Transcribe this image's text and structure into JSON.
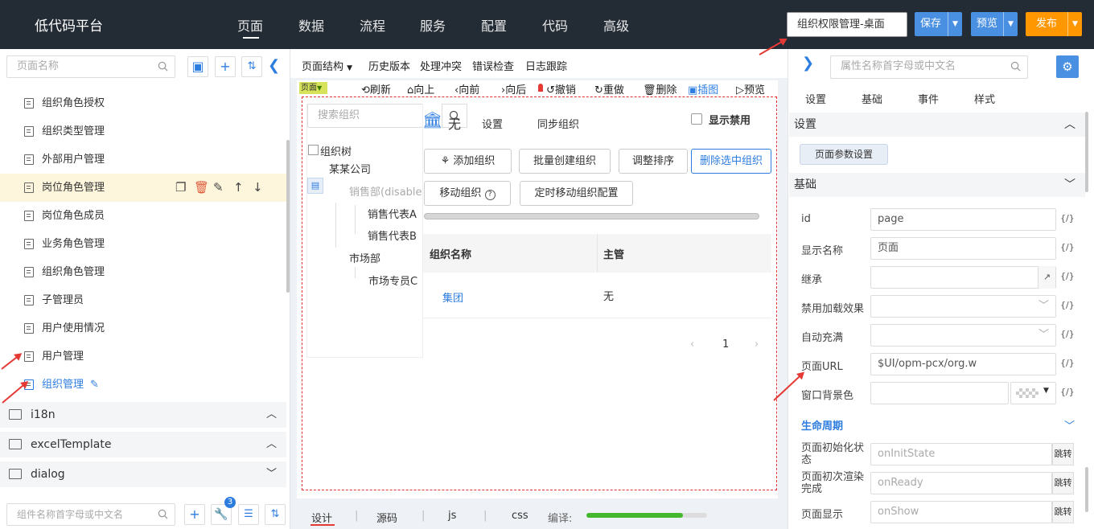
{
  "brand": "低代码平台",
  "nav": [
    "页面",
    "数据",
    "流程",
    "服务",
    "配置",
    "代码",
    "高级"
  ],
  "page_select": "组织权限管理-桌面",
  "actions": {
    "save": "保存",
    "preview": "预览",
    "publish": "发布"
  },
  "colors": {
    "topbar": "#232b35",
    "save": "#4a90e2",
    "publish": "#ff9800",
    "accent": "#2d7de0"
  },
  "left": {
    "search_placeholder": "页面名称",
    "items": [
      "组织角色授权",
      "组织类型管理",
      "外部用户管理",
      "岗位角色管理",
      "岗位角色成员",
      "业务角色管理",
      "组织角色管理",
      "子管理员",
      "用户使用情况",
      "用户管理",
      "组织管理"
    ],
    "folders": [
      "i18n",
      "excelTemplate",
      "dialog"
    ],
    "component_search_placeholder": "组件名称首字母或中文名",
    "badge_count": "3"
  },
  "toolbar1": [
    "页面结构",
    "历史版本",
    "处理冲突",
    "错误检查",
    "日志跟踪"
  ],
  "toolbar2": {
    "page_tag": "页面",
    "refresh": "刷新",
    "up": "向上",
    "prev": "向前",
    "next": "向后",
    "undo": "撤销",
    "redo": "重做",
    "delete": "删除",
    "image": "插图",
    "preview": "预览"
  },
  "org": {
    "search_placeholder": "搜索组织",
    "bank_none": "无",
    "settings": "设置",
    "sync": "同步组织",
    "show_disabled": "显示禁用",
    "tree_root": "组织树",
    "tree": [
      "某某公司",
      "销售部(disabled",
      "销售代表A",
      "销售代表B",
      "市场部",
      "市场专员C"
    ],
    "buttons": [
      "添加组织",
      "批量创建组织",
      "调整排序",
      "删除选中组织",
      "移动组织",
      "定时移动组织配置"
    ],
    "table_headers": [
      "组织名称",
      "主管"
    ],
    "row": {
      "name": "集团",
      "manager": "无"
    },
    "page_num": "1"
  },
  "bottom_tabs": [
    "设计",
    "源码",
    "js",
    "css"
  ],
  "compile_label": "编译:",
  "compile_progress": 0.8,
  "right": {
    "search_placeholder": "属性名称首字母或中文名",
    "tabs": [
      "设置",
      "基础",
      "事件",
      "样式"
    ],
    "sec_settings": "设置",
    "page_param_btn": "页面参数设置",
    "sec_basic": "基础",
    "props": [
      {
        "label": "id",
        "value": "page"
      },
      {
        "label": "显示名称",
        "value": "页面"
      },
      {
        "label": "继承",
        "value": ""
      },
      {
        "label": "禁用加载效果",
        "value": ""
      },
      {
        "label": "自动充满",
        "value": ""
      },
      {
        "label": "页面URL",
        "value": "$UI/opm-pcx/org.w"
      },
      {
        "label": "窗口背景色",
        "value": ""
      }
    ],
    "expr_icon": "{/}",
    "lifecycle": "生命周期",
    "lifecycle_items": [
      {
        "label": "页面初始化状态",
        "value": "onInitState"
      },
      {
        "label": "页面初次渲染完成",
        "value": "onReady"
      },
      {
        "label": "页面显示",
        "value": "onShow"
      }
    ],
    "jump": "跳转"
  }
}
